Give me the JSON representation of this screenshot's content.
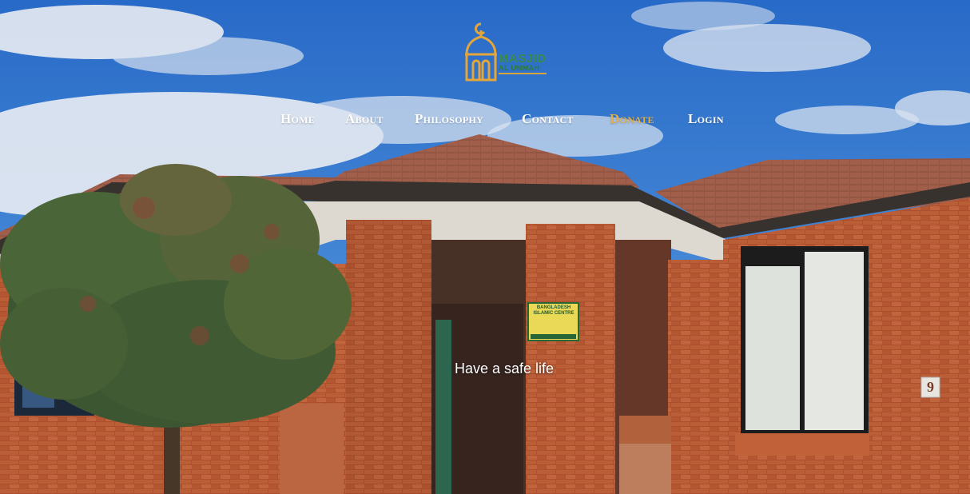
{
  "logo": {
    "title": "MASJID",
    "subtitle": "AL UMMAH",
    "icon": "mosque-dome-icon",
    "colors": {
      "gold": "#e4a63a",
      "green": "#2b7a3d"
    }
  },
  "nav": {
    "items": [
      {
        "label": "Home"
      },
      {
        "label": "About"
      },
      {
        "label": "Philosophy"
      },
      {
        "label": "Contact"
      },
      {
        "label": "Donate",
        "active": true
      },
      {
        "label": "Login"
      }
    ],
    "active_color": "#e4b04a"
  },
  "hero": {
    "tagline": "Have a safe life",
    "sign_text": "BANGLADESH ISLAMIC CENTRE",
    "house_number": "9"
  }
}
